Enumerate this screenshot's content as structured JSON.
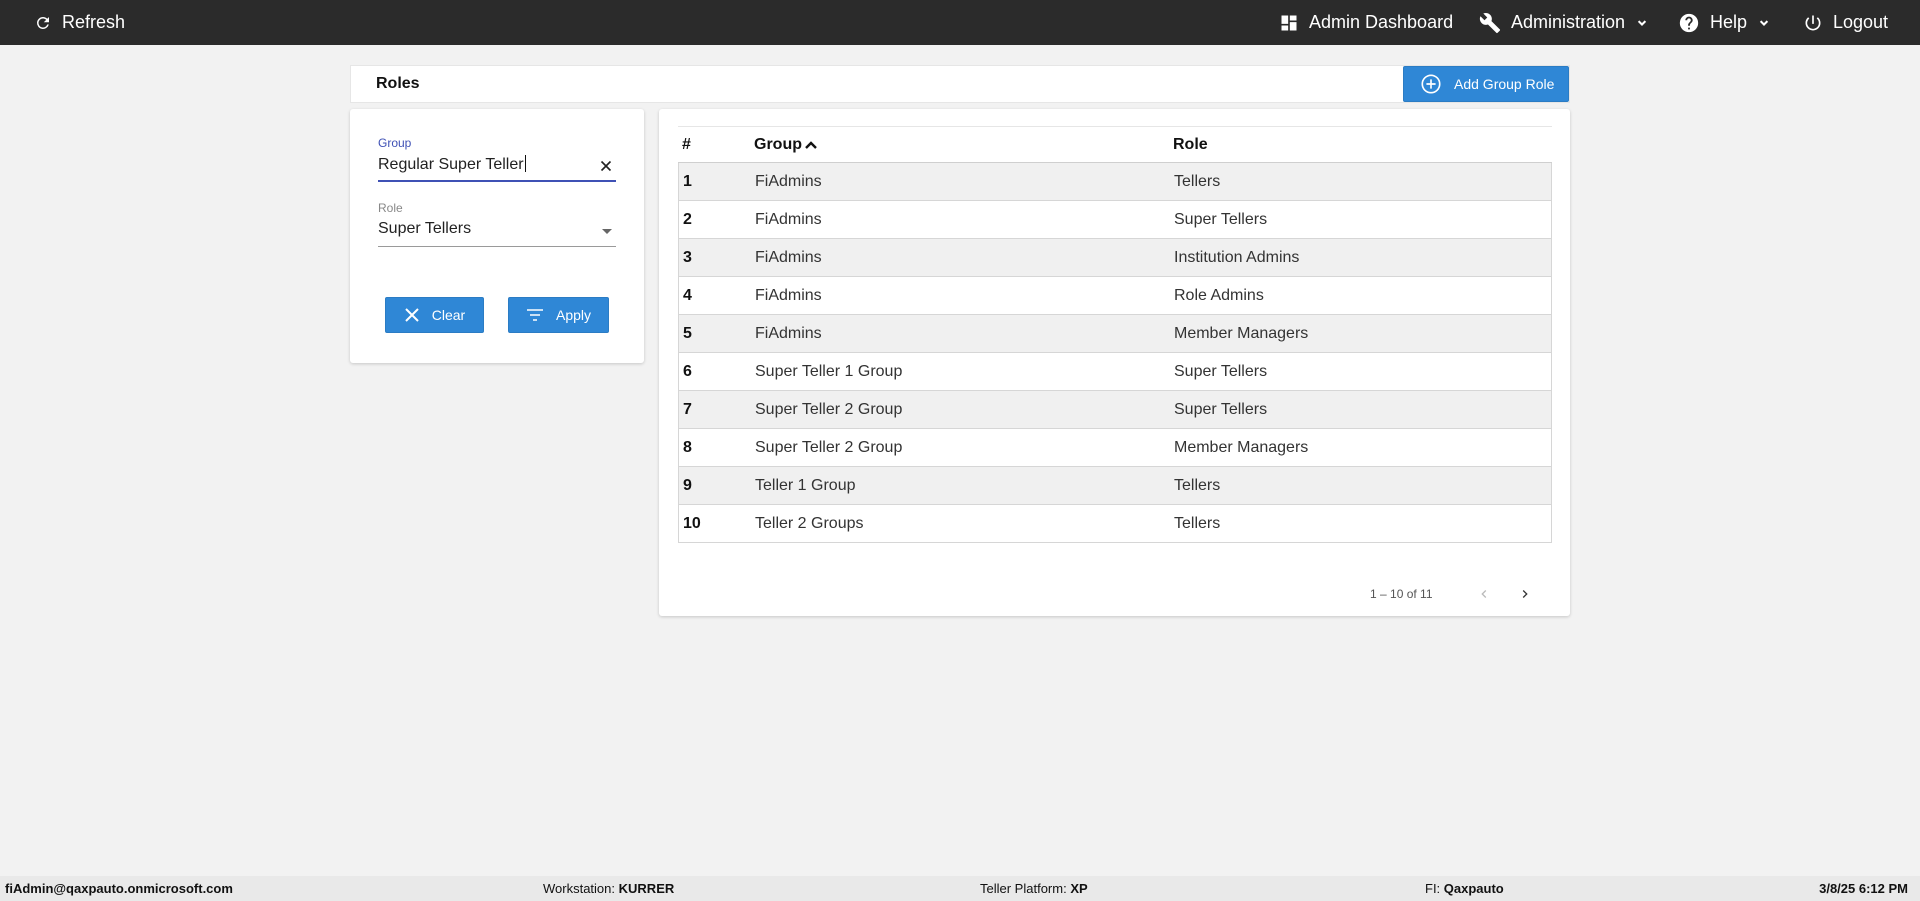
{
  "topbar": {
    "refresh_label": "Refresh",
    "admin_dashboard_label": "Admin Dashboard",
    "administration_label": "Administration",
    "help_label": "Help",
    "logout_label": "Logout"
  },
  "page": {
    "title": "Roles",
    "add_button_label": "Add Group Role"
  },
  "filters": {
    "group_label": "Group",
    "group_value": "Regular Super Teller",
    "role_label": "Role",
    "role_value": "Super Tellers",
    "clear_label": "Clear",
    "apply_label": "Apply"
  },
  "table": {
    "columns": [
      "#",
      "Group",
      "Role"
    ],
    "rows": [
      {
        "num": "1",
        "group": "FiAdmins",
        "role": "Tellers"
      },
      {
        "num": "2",
        "group": "FiAdmins",
        "role": "Super Tellers"
      },
      {
        "num": "3",
        "group": "FiAdmins",
        "role": "Institution Admins"
      },
      {
        "num": "4",
        "group": "FiAdmins",
        "role": "Role Admins"
      },
      {
        "num": "5",
        "group": "FiAdmins",
        "role": "Member Managers"
      },
      {
        "num": "6",
        "group": "Super Teller 1 Group",
        "role": "Super Tellers"
      },
      {
        "num": "7",
        "group": "Super Teller 2 Group",
        "role": "Super Tellers"
      },
      {
        "num": "8",
        "group": "Super Teller 2 Group",
        "role": "Member Managers"
      },
      {
        "num": "9",
        "group": "Teller 1 Group",
        "role": "Tellers"
      },
      {
        "num": "10",
        "group": "Teller 2 Groups",
        "role": "Tellers"
      }
    ],
    "pager_range": "1 – 10 of 11"
  },
  "footer": {
    "user": "fiAdmin@qaxpauto.onmicrosoft.com",
    "workstation_label": "Workstation:",
    "workstation_value": "KURRER",
    "platform_label": "Teller Platform:",
    "platform_value": "XP",
    "fi_label": "FI:",
    "fi_value": "Qaxpauto",
    "datetime": "3/8/25 6:12 PM"
  },
  "colors": {
    "topbar_bg": "#2b2b2b",
    "accent_blue": "#2f87d6",
    "focus_indigo": "#3f51b5"
  }
}
